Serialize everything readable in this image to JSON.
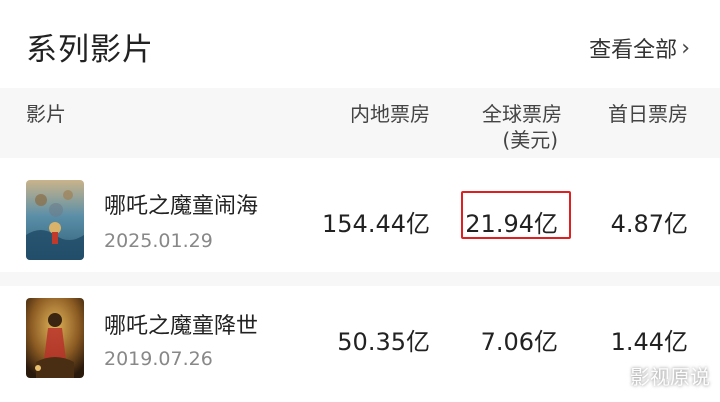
{
  "header": {
    "section_title": "系列影片",
    "view_all_label": "查看全部",
    "view_all_icon": "chevron-right-icon"
  },
  "columns": {
    "film": "影片",
    "domestic": "内地票房",
    "global": "全球票房",
    "global_unit": "(美元)",
    "first_day": "首日票房"
  },
  "films": [
    {
      "title": "哪吒之魔童闹海",
      "date": "2025.01.29",
      "domestic": "154.44亿",
      "global": "21.94亿",
      "first_day": "4.87亿",
      "global_highlighted": true
    },
    {
      "title": "哪吒之魔童降世",
      "date": "2019.07.26",
      "domestic": "50.35亿",
      "global": "7.06亿",
      "first_day": "1.44亿",
      "global_highlighted": false
    }
  ],
  "watermark": "影视原说",
  "colors": {
    "highlight_border": "#e02020",
    "header_bg": "#f7f7f7"
  }
}
